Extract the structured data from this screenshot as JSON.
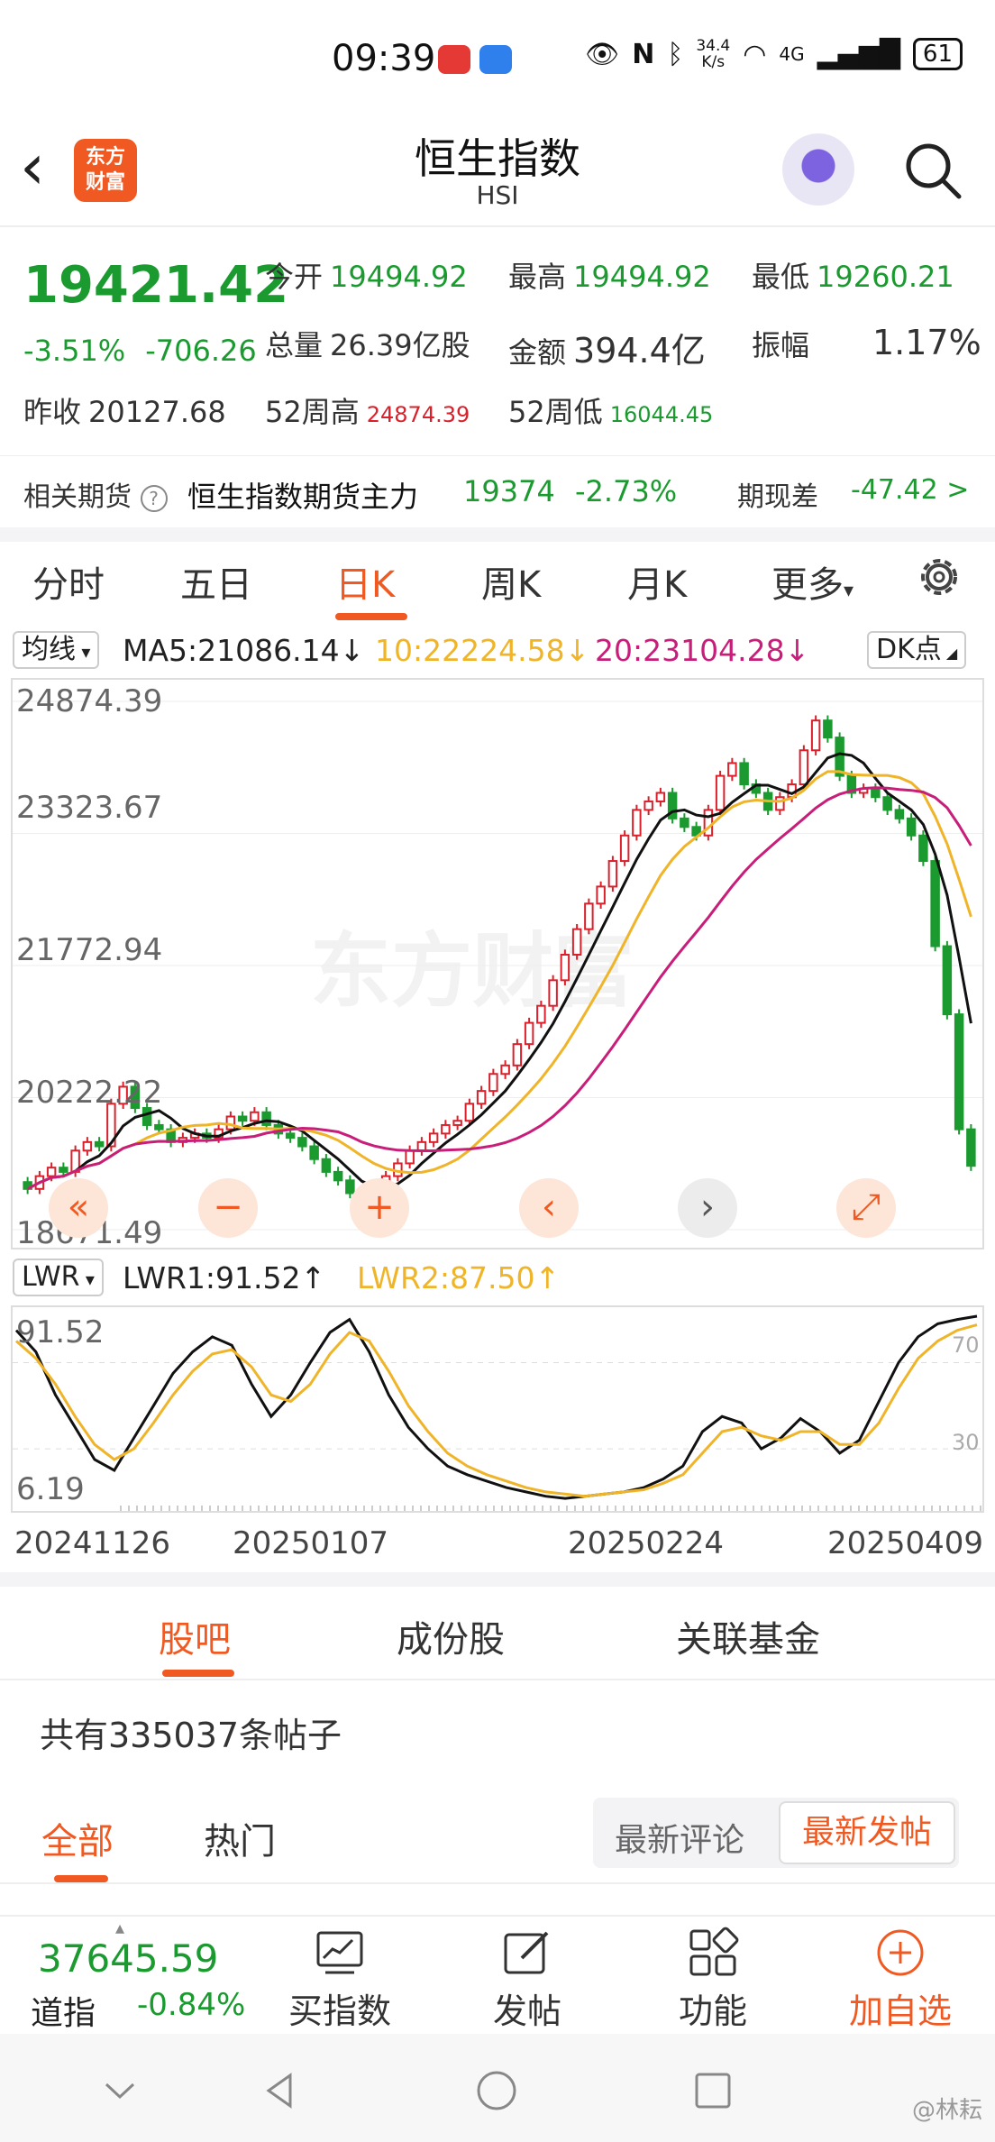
{
  "status_bar": {
    "time": "09:39",
    "net_speed_value": "34.4",
    "net_speed_unit": "K/s",
    "network": "4G",
    "battery": "61"
  },
  "header": {
    "logo_line1": "东方",
    "logo_line2": "财富",
    "title": "恒生指数",
    "subtitle": "HSI"
  },
  "quote": {
    "price": "19421.42",
    "change_pct": "-3.51%",
    "change": "-706.26",
    "open_label": "今开",
    "open": "19494.92",
    "high_label": "最高",
    "high": "19494.92",
    "low_label": "最低",
    "low": "19260.21",
    "volume_label": "总量",
    "volume": "26.39亿股",
    "amount_label": "金额",
    "amount": "394.4亿",
    "amplitude_label": "振幅",
    "amplitude": "1.17%",
    "prev_close_label": "昨收",
    "prev_close": "20127.68",
    "high52_label": "52周高",
    "high52": "24874.39",
    "low52_label": "52周低",
    "low52": "16044.45"
  },
  "futures": {
    "label": "相关期货",
    "name": "恒生指数期货主力",
    "price": "19374",
    "pct": "-2.73%",
    "basis_label": "期现差",
    "basis": "-47.42 >"
  },
  "periods": [
    "分时",
    "五日",
    "日K",
    "周K",
    "月K",
    "更多"
  ],
  "ma_row": {
    "selector": "均线",
    "ma5": "MA5:21086.14↓",
    "ma10": "10:22224.58↓",
    "ma20": "20:23104.28↓",
    "dk": "DK点"
  },
  "lwr_row": {
    "selector": "LWR",
    "lwr1": "LWR1:91.52↑",
    "lwr2": "LWR2:87.50↑"
  },
  "x_axis_dates": [
    "20241126",
    "20250107",
    "20250224",
    "20250409"
  ],
  "colors": {
    "accent": "#f05a22",
    "down_green": "#1a9a2f",
    "up_red": "#d9202b",
    "ma5": "#111111",
    "ma10": "#f0b429",
    "ma20": "#c81e7a"
  },
  "chart_data": [
    {
      "type": "candlestick",
      "title": "",
      "y_ticks": [
        "24874.39",
        "23323.67",
        "21772.94",
        "20222.22",
        "18671.49"
      ],
      "ylim": [
        18671.49,
        24874.39
      ],
      "x_ticks": [
        "20241126",
        "20250107",
        "20250224",
        "20250409"
      ],
      "watermark": "东方财富",
      "close_series": [
        19150,
        19300,
        19400,
        19350,
        19600,
        19700,
        19650,
        20150,
        20350,
        20100,
        19900,
        19850,
        19700,
        19750,
        19800,
        19750,
        19850,
        20000,
        19950,
        20050,
        19900,
        19800,
        19750,
        19650,
        19500,
        19350,
        19250,
        19100,
        19000,
        19200,
        19300,
        19450,
        19600,
        19700,
        19800,
        19900,
        19950,
        20150,
        20300,
        20500,
        20600,
        20850,
        21100,
        21300,
        21600,
        21900,
        22200,
        22500,
        22700,
        23000,
        23300,
        23600,
        23700,
        23800,
        23500,
        23400,
        23300,
        23600,
        24000,
        24150,
        23900,
        23800,
        23600,
        23750,
        23900,
        24300,
        24650,
        24450,
        24000,
        23800,
        23850,
        23750,
        23600,
        23500,
        23300,
        23000,
        22000,
        21200,
        19850,
        19421
      ],
      "ma_series": [
        {
          "name": "MA5",
          "value": "21086.14"
        },
        {
          "name": "MA10",
          "value": "22224.58"
        },
        {
          "name": "MA20",
          "value": "23104.28"
        }
      ]
    },
    {
      "type": "line",
      "title": "",
      "y_ticks": [
        "91.52",
        "6.19"
      ],
      "reference_levels": [
        "70",
        "30"
      ],
      "ylim": [
        6.19,
        91.52
      ],
      "series": [
        {
          "name": "LWR1",
          "values": [
            85,
            75,
            55,
            40,
            25,
            20,
            35,
            50,
            65,
            75,
            82,
            78,
            60,
            45,
            55,
            70,
            84,
            90,
            75,
            55,
            40,
            30,
            22,
            18,
            15,
            12,
            10,
            8,
            7,
            8,
            9,
            10,
            12,
            16,
            22,
            38,
            45,
            42,
            30,
            35,
            44,
            38,
            28,
            34,
            52,
            70,
            82,
            88,
            90,
            91.52
          ]
        },
        {
          "name": "LWR2",
          "values": [
            80,
            72,
            60,
            45,
            32,
            25,
            30,
            42,
            55,
            66,
            74,
            76,
            68,
            55,
            52,
            60,
            74,
            84,
            80,
            66,
            50,
            38,
            28,
            22,
            18,
            15,
            12,
            10,
            9,
            8,
            9,
            10,
            11,
            14,
            18,
            28,
            38,
            40,
            36,
            34,
            38,
            38,
            32,
            32,
            42,
            58,
            72,
            80,
            85,
            87.5
          ]
        }
      ]
    }
  ],
  "tabs": [
    "股吧",
    "成份股",
    "关联基金"
  ],
  "post_count": "共有335037条帖子",
  "feed_tabs": [
    "全部",
    "热门"
  ],
  "sort": {
    "a": "最新评论",
    "b": "最新发帖"
  },
  "bottom": {
    "index_price": "37645.59",
    "index_name": "道指",
    "index_pct": "-0.84%",
    "buy": "买指数",
    "post": "发帖",
    "func": "功能",
    "add": "加自选"
  },
  "credit": "@林耘"
}
